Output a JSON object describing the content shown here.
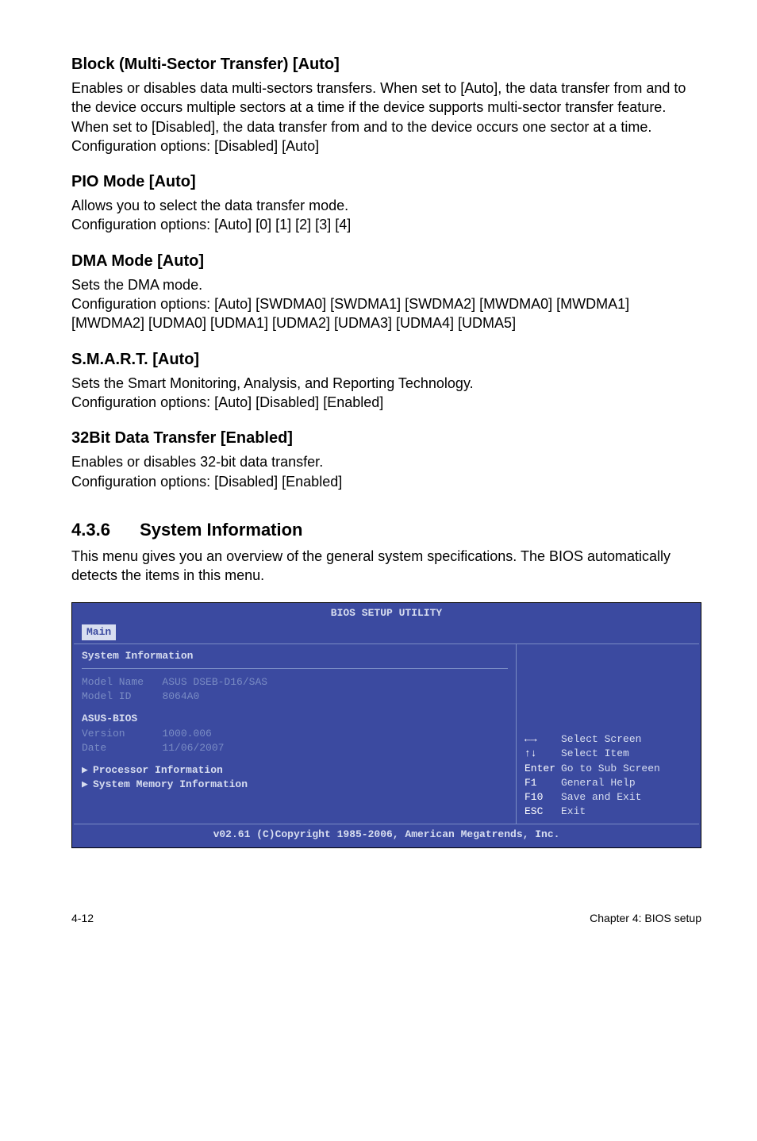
{
  "sections": [
    {
      "heading": "Block (Multi-Sector Transfer) [Auto]",
      "body": "Enables or disables data multi-sectors transfers. When set to [Auto], the data transfer from and to the device occurs multiple sectors at a time if the device supports multi-sector transfer feature. When set to [Disabled], the data transfer from and to the device occurs one sector at a time.\nConfiguration options: [Disabled] [Auto]"
    },
    {
      "heading": "PIO Mode [Auto]",
      "body": "Allows you to select the data transfer mode.\nConfiguration options: [Auto] [0] [1] [2] [3] [4]"
    },
    {
      "heading": "DMA Mode [Auto]",
      "body": "Sets the DMA mode.\nConfiguration options: [Auto] [SWDMA0] [SWDMA1] [SWDMA2] [MWDMA0] [MWDMA1] [MWDMA2] [UDMA0] [UDMA1] [UDMA2] [UDMA3] [UDMA4] [UDMA5]"
    },
    {
      "heading": "S.M.A.R.T. [Auto]",
      "body": "Sets the Smart Monitoring, Analysis, and Reporting Technology.\nConfiguration options: [Auto] [Disabled] [Enabled]"
    },
    {
      "heading": "32Bit Data Transfer [Enabled]",
      "body": "Enables or disables 32-bit data transfer.\nConfiguration options: [Disabled] [Enabled]"
    }
  ],
  "main_section": {
    "number": "4.3.6",
    "title": "System Information",
    "intro": "This menu gives you an overview of the general system specifications. The BIOS automatically detects the items in this menu."
  },
  "bios": {
    "title": "BIOS SETUP UTILITY",
    "tab": "Main",
    "header": "System Information",
    "rows": {
      "model_name_label": "Model Name",
      "model_name_value": "ASUS DSEB-D16/SAS",
      "model_id_label": "Model ID",
      "model_id_value": "8064A0",
      "asus_bios": "ASUS-BIOS",
      "version_label": "Version",
      "version_value": "1000.006",
      "date_label": "Date",
      "date_value": "11/06/2007",
      "proc_info": "Processor Information",
      "mem_info": "System Memory Information"
    },
    "help": [
      {
        "key": "←→",
        "desc": "Select Screen"
      },
      {
        "key": "↑↓",
        "desc": "Select Item"
      },
      {
        "key": "Enter",
        "desc": "Go to Sub Screen"
      },
      {
        "key": "F1",
        "desc": "General Help"
      },
      {
        "key": "F10",
        "desc": "Save and Exit"
      },
      {
        "key": "ESC",
        "desc": "Exit"
      }
    ],
    "footer": "v02.61 (C)Copyright 1985-2006, American Megatrends, Inc."
  },
  "page_footer": {
    "left": "4-12",
    "right": "Chapter 4: BIOS setup"
  }
}
